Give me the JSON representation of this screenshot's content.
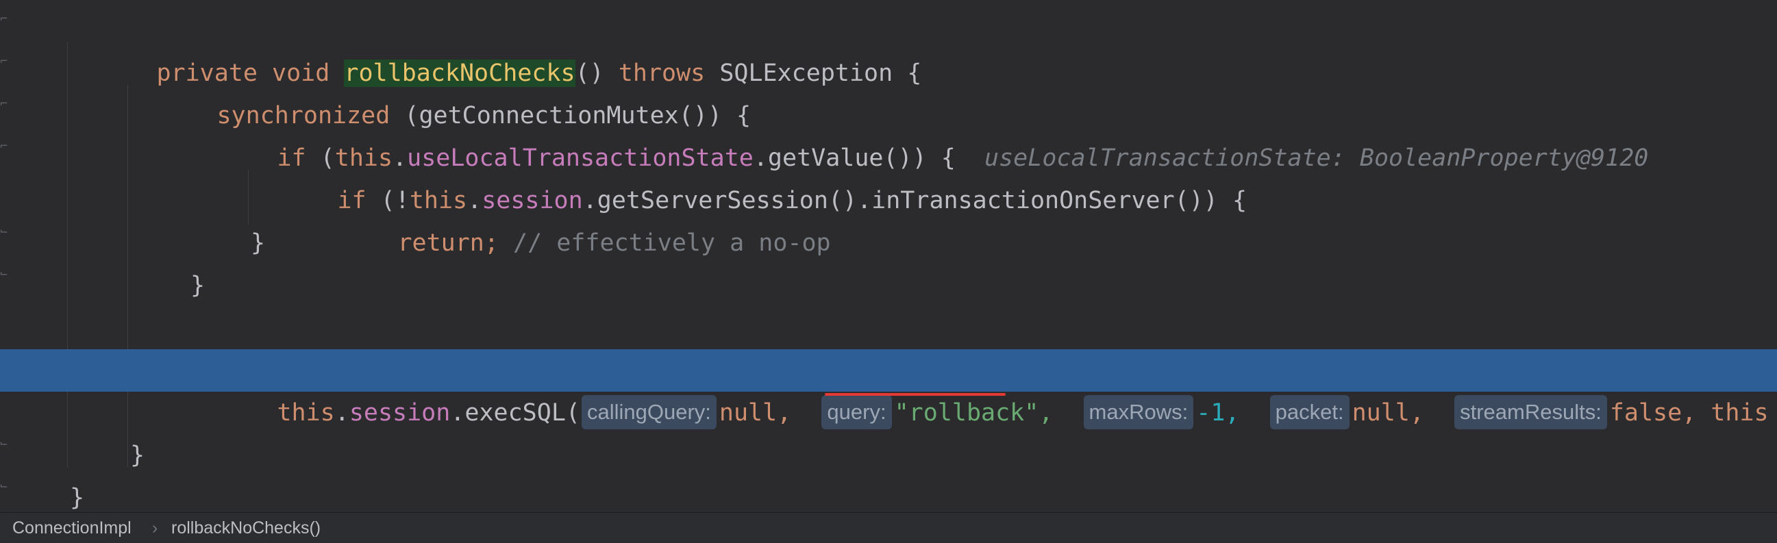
{
  "code": {
    "line1": {
      "kw_private": "private",
      "kw_void": "void",
      "method_name": "rollbackNoChecks",
      "parens": "()",
      "kw_throws": "throws",
      "exception": "SQLException",
      "brace": "{"
    },
    "line2": {
      "kw_synchronized": "synchronized",
      "rest": "(getConnectionMutex()) {"
    },
    "line3": {
      "kw_if": "if",
      "open": "(",
      "kw_this": "this",
      "dot": ".",
      "field": "useLocalTransactionState",
      "rest": ".getValue()) {",
      "inline_hint": "useLocalTransactionState: BooleanProperty@9120"
    },
    "line4": {
      "kw_if": "if",
      "open": "(!",
      "kw_this": "this",
      "dot": ".",
      "field": "session",
      "rest": ".getServerSession().inTransactionOnServer()) {"
    },
    "line5": {
      "kw_return": "return;",
      "comment": "// effectively a no-op"
    },
    "line6": {
      "brace": "}"
    },
    "line7": {
      "brace": "}"
    },
    "line9": {
      "kw_this": "this",
      "dot": ".",
      "field": "session",
      "call": ".execSQL(",
      "hint_callingQuery": "callingQuery:",
      "val_callingQuery": "null,",
      "hint_query": "query:",
      "val_query": "\"rollback\",",
      "hint_maxRows": "maxRows:",
      "val_maxRows": "-1,",
      "hint_packet": "packet:",
      "val_packet": "null,",
      "hint_streamResults": "streamResults:",
      "val_streamResults": "false,",
      "val_this": "this"
    },
    "line11": {
      "brace": "}"
    },
    "line12": {
      "brace": "}"
    }
  },
  "breadcrumb": {
    "class_name": "ConnectionImpl",
    "separator": "›",
    "method_name": "rollbackNoChecks()"
  }
}
